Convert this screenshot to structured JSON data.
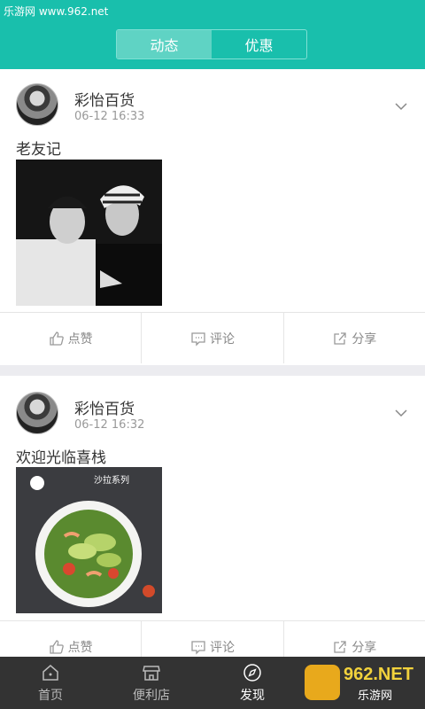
{
  "watermark_top": "乐游网 www.962.net",
  "header": {
    "tabs": [
      {
        "label": "动态",
        "active": true
      },
      {
        "label": "优惠",
        "active": false
      }
    ]
  },
  "posts": [
    {
      "author": "彩怡百货",
      "time": "06-12 16:33",
      "text": "老友记",
      "image": "people-photo"
    },
    {
      "author": "彩怡百货",
      "time": "06-12 16:32",
      "text": "欢迎光临喜栈",
      "image": "salad-photo",
      "image_title": "沙拉系列"
    }
  ],
  "actions": {
    "like": "点赞",
    "comment": "评论",
    "share": "分享"
  },
  "tabbar": {
    "items": [
      {
        "label": "首页",
        "icon": "home-icon",
        "active": false
      },
      {
        "label": "便利店",
        "icon": "store-icon",
        "active": false
      },
      {
        "label": "发现",
        "icon": "compass-icon",
        "active": true
      }
    ]
  },
  "watermark_bottom": {
    "brand": "962.NET",
    "sub": "乐游网"
  },
  "colors": {
    "accent": "#19bfac",
    "tabbar": "#333333"
  }
}
